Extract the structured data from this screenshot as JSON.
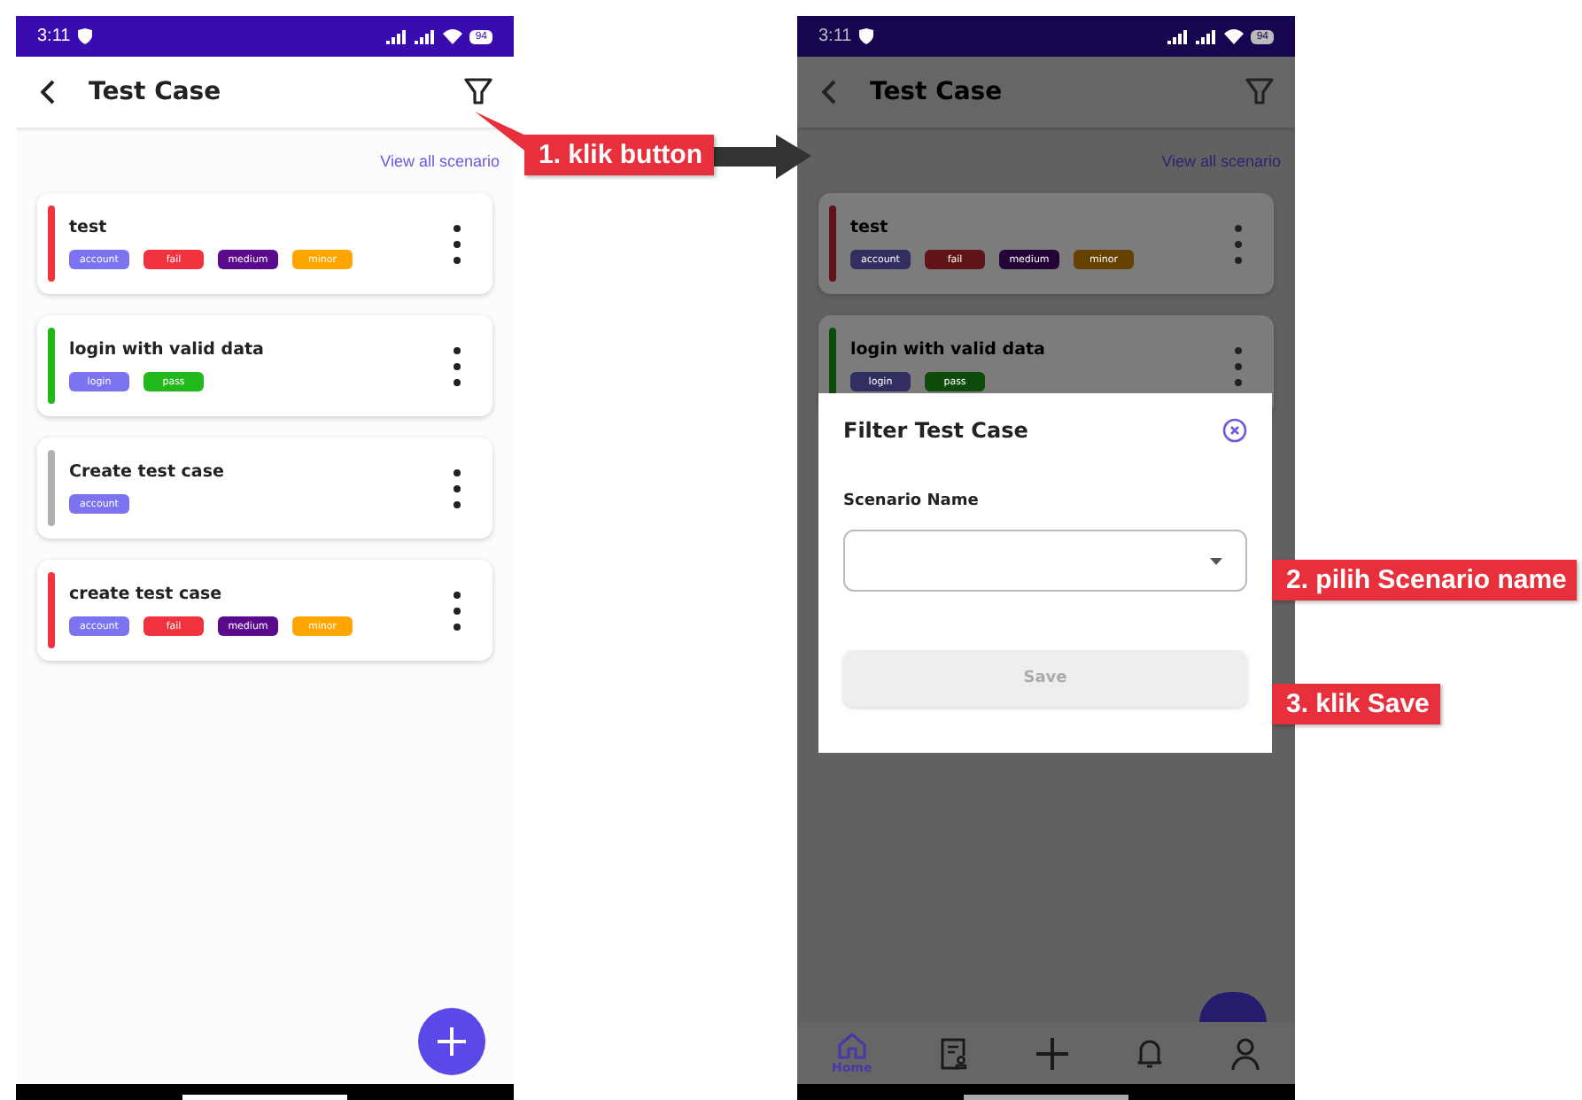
{
  "screens": [
    {
      "time": "3:11",
      "battery": "94",
      "title": "Test Case",
      "link": "View all scenario",
      "dimmed": false,
      "cards": [
        {
          "title": "test",
          "color": "#f0333f",
          "tags": [
            {
              "label": "account",
              "color": "#7b73f0"
            },
            {
              "label": "fail",
              "color": "#f0333f"
            },
            {
              "label": "medium",
              "color": "#5a0a8a"
            },
            {
              "label": "minor",
              "color": "#ffa500"
            }
          ]
        },
        {
          "title": "login with valid data",
          "color": "#22b81b",
          "tags": [
            {
              "label": "login",
              "color": "#7b73f0"
            },
            {
              "label": "pass",
              "color": "#22b81b"
            }
          ]
        },
        {
          "title": "Create test case",
          "color": "#b0b0b0",
          "tags": [
            {
              "label": "account",
              "color": "#7b73f0"
            }
          ]
        },
        {
          "title": "create test case",
          "color": "#f0333f",
          "tags": [
            {
              "label": "account",
              "color": "#7b73f0"
            },
            {
              "label": "fail",
              "color": "#f0333f"
            },
            {
              "label": "medium",
              "color": "#5a0a8a"
            },
            {
              "label": "minor",
              "color": "#ffa500"
            }
          ]
        }
      ]
    },
    {
      "time": "3:11",
      "battery": "94",
      "title": "Test Case",
      "link": "View all scenario",
      "dimmed": true,
      "cards": [
        {
          "title": "test",
          "color": "#601418",
          "tags": [
            {
              "label": "account",
              "color": "#312e60"
            },
            {
              "label": "fail",
              "color": "#601418"
            },
            {
              "label": "medium",
              "color": "#240437"
            },
            {
              "label": "minor",
              "color": "#664200"
            }
          ]
        },
        {
          "title": "login with valid data",
          "color": "#0e4a0b",
          "tags": [
            {
              "label": "login",
              "color": "#312e60"
            },
            {
              "label": "pass",
              "color": "#0e4a0b"
            }
          ]
        }
      ],
      "dialog": {
        "title": "Filter Test Case",
        "field_label": "Scenario Name",
        "save": "Save",
        "save_disabled": true
      },
      "nav": [
        {
          "kind": "home",
          "label": "Home",
          "selected": true
        },
        {
          "kind": "document",
          "selected": false
        },
        {
          "kind": "add",
          "selected": false
        },
        {
          "kind": "bell",
          "selected": false
        },
        {
          "kind": "user",
          "selected": false
        }
      ]
    }
  ],
  "annotations": [
    {
      "text": "1. klik button"
    },
    {
      "text": "2. pilih Scenario name"
    },
    {
      "text": "3. klik Save"
    }
  ]
}
